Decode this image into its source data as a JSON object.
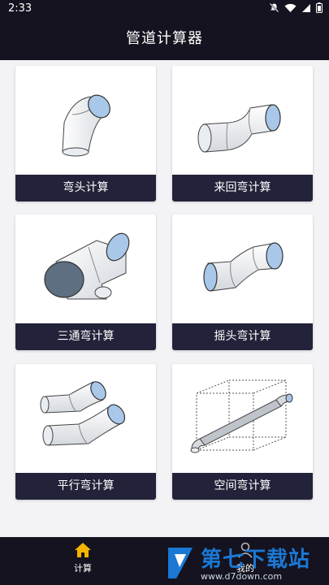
{
  "status": {
    "time": "2:33"
  },
  "app": {
    "title": "管道计算器"
  },
  "cards": [
    {
      "label": "弯头计算",
      "icon": "elbow-pipe-icon"
    },
    {
      "label": "来回弯计算",
      "icon": "offset-pipe-icon"
    },
    {
      "label": "三通弯计算",
      "icon": "tee-pipe-icon"
    },
    {
      "label": "摇头弯计算",
      "icon": "rolling-offset-pipe-icon"
    },
    {
      "label": "平行弯计算",
      "icon": "parallel-pipes-icon"
    },
    {
      "label": "空间弯计算",
      "icon": "spatial-pipe-icon"
    }
  ],
  "nav": [
    {
      "label": "计算",
      "icon": "home-icon",
      "active": true
    },
    {
      "label": "我的",
      "icon": "user-icon",
      "active": false
    }
  ],
  "watermark": {
    "title": "第七下载站",
    "url": "www.d7down.com"
  },
  "colors": {
    "bar": "#14131f",
    "card_label": "#22223a",
    "pipe_end": "#a9c7e8",
    "accent": "#f4b400"
  }
}
